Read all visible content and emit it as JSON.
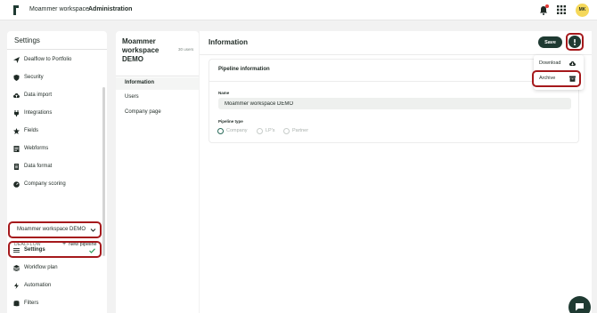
{
  "topbar": {
    "workspace_name": "Moammer workspace",
    "section": "Administration",
    "avatar_initials": "MK"
  },
  "left_panel": {
    "title": "Settings",
    "items": [
      {
        "label": "Dealflow to Portfolio",
        "icon": "send-icon"
      },
      {
        "label": "Security",
        "icon": "shield-icon"
      },
      {
        "label": "Data import",
        "icon": "cloud-upload-icon"
      },
      {
        "label": "Integrations",
        "icon": "plug-icon"
      },
      {
        "label": "Fields",
        "icon": "star-icon"
      },
      {
        "label": "Webforms",
        "icon": "form-icon"
      },
      {
        "label": "Data format",
        "icon": "document-icon"
      },
      {
        "label": "Company scoring",
        "icon": "gauge-icon"
      }
    ],
    "dealflow_label": "DEALFLOW",
    "new_pipeline_label": "New pipeline",
    "workspace_select": "Moammer workspace DEMO",
    "pipeline_items": [
      {
        "label": "Settings",
        "icon": "list-icon"
      },
      {
        "label": "Workflow plan",
        "icon": "layers-icon"
      },
      {
        "label": "Automation",
        "icon": "bolt-icon"
      },
      {
        "label": "Filters",
        "icon": "database-icon"
      }
    ]
  },
  "mid_panel": {
    "title": "Moammer workspace DEMO",
    "users_count": "30 users",
    "tabs": [
      "Information",
      "Users",
      "Company page"
    ]
  },
  "main": {
    "title": "Information",
    "save_label": "Save",
    "card_title": "Pipeline information",
    "name_label": "Name",
    "name_value": "Moammer workspace DEMO",
    "type_label": "Pipeline type",
    "type_options": [
      "Company",
      "LP's",
      "Partner"
    ],
    "selected_type": "Company"
  },
  "menu": {
    "items": [
      {
        "label": "Download",
        "icon": "cloud-download-icon"
      },
      {
        "label": "Archive",
        "icon": "archive-icon"
      }
    ]
  },
  "colors": {
    "accent": "#1f3a32",
    "highlight": "#a5191c",
    "avatar": "#f5d85a",
    "check": "#2e9e5b"
  }
}
